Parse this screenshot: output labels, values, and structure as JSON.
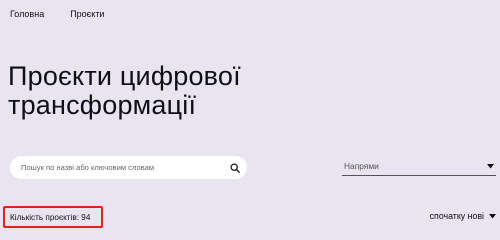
{
  "nav": {
    "items": [
      {
        "label": "Головна"
      },
      {
        "label": "Проєкти"
      }
    ]
  },
  "hero": {
    "title_line1": "Проєкти цифрової",
    "title_line2": "трансформації"
  },
  "search": {
    "placeholder": "Пошук по назві або ключовим словам",
    "value": "",
    "icon": "search-icon"
  },
  "filter": {
    "directions_label": "Напрями",
    "icon": "chevron-down-icon"
  },
  "results": {
    "count_label": "Кількість проєктів: 94"
  },
  "sort": {
    "label": "спочатку нові",
    "icon": "chevron-down-icon"
  },
  "colors": {
    "background": "#e8e5f0",
    "highlight_border": "#e2231a"
  }
}
